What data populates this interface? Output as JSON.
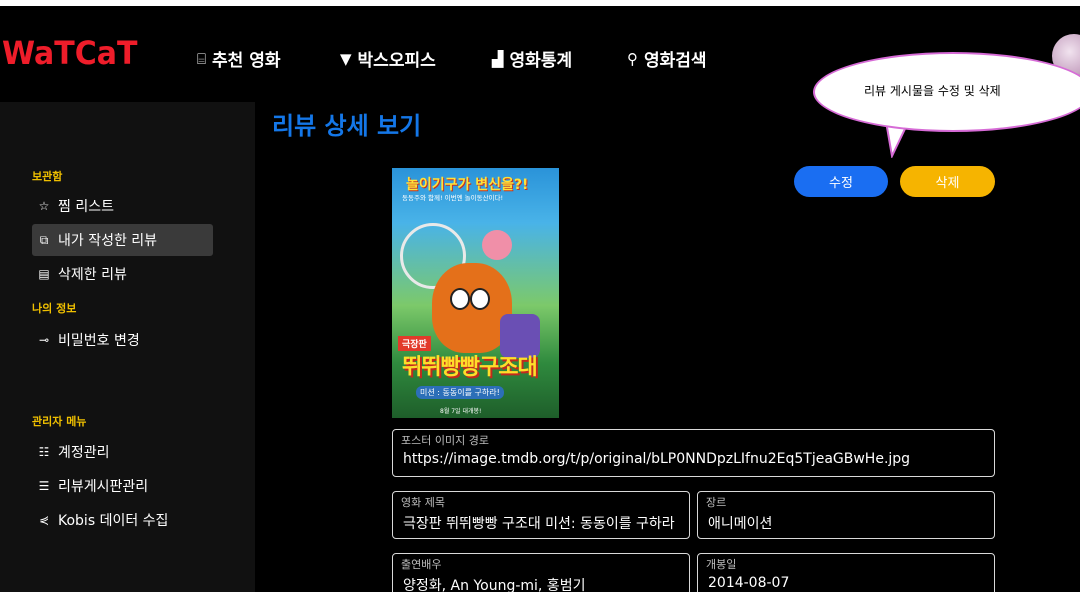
{
  "app": {
    "logo": "WaTCaT"
  },
  "nav": [
    {
      "icon": "list-icon",
      "glyph": "⌸",
      "label": "추천 영화"
    },
    {
      "icon": "trophy-icon",
      "glyph": "🏆",
      "label": "박스오피스"
    },
    {
      "icon": "bar-chart-icon",
      "glyph": "▟",
      "label": "영화통계"
    },
    {
      "icon": "search-icon",
      "glyph": "⚲",
      "label": "영화검색"
    }
  ],
  "sidebar": {
    "section1": "보관함",
    "items1": [
      {
        "glyph": "☆",
        "label": "찜 리스트"
      },
      {
        "glyph": "⧉",
        "label": "내가 작성한 리뷰"
      },
      {
        "glyph": "▤",
        "label": "삭제한 리뷰"
      }
    ],
    "section2": "나의 정보",
    "items2": [
      {
        "glyph": "⊸",
        "label": "비밀번호 변경"
      }
    ],
    "section3": "관리자 메뉴",
    "items3": [
      {
        "glyph": "☷",
        "label": "계정관리"
      },
      {
        "glyph": "☰",
        "label": "리뷰게시판관리"
      },
      {
        "glyph": "⋞",
        "label": "Kobis 데이터 수집"
      }
    ]
  },
  "main": {
    "title": "리뷰 상세 보기",
    "edit_label": "수정",
    "delete_label": "삭제",
    "poster": {
      "headline": "놀이기구가 변신을?!",
      "subline": "동동주와 함께! 이번엔 놀이동산이다!",
      "badge": "극장판",
      "big_title": "뛰뛰빵빵구조대",
      "mission": "미션 : 동동이를 구하라!",
      "release": "8월 7일 대개봉!"
    },
    "fields": {
      "poster_path": {
        "label": "포스터 이미지 경로",
        "value": "https://image.tmdb.org/t/p/original/bLP0NNDpzLIfnu2Eq5TjeaGBwHe.jpg"
      },
      "movie_title": {
        "label": "영화 제목",
        "value": "극장판 뛰뛰빵빵 구조대 미션: 동동이를 구하라"
      },
      "genre": {
        "label": "장르",
        "value": "애니메이션"
      },
      "cast": {
        "label": "출연배우",
        "value": "양정화, An Young-mi, 홍범기"
      },
      "release_date": {
        "label": "개봉일",
        "value": "2014-08-07"
      }
    }
  },
  "callout": {
    "text": "리뷰 게시물을 수정 및 삭제"
  },
  "colors": {
    "logo": "#ef1d2a",
    "title": "#1477e8",
    "edit": "#1a6ef2",
    "delete": "#f6b400",
    "section": "#f0c000"
  }
}
